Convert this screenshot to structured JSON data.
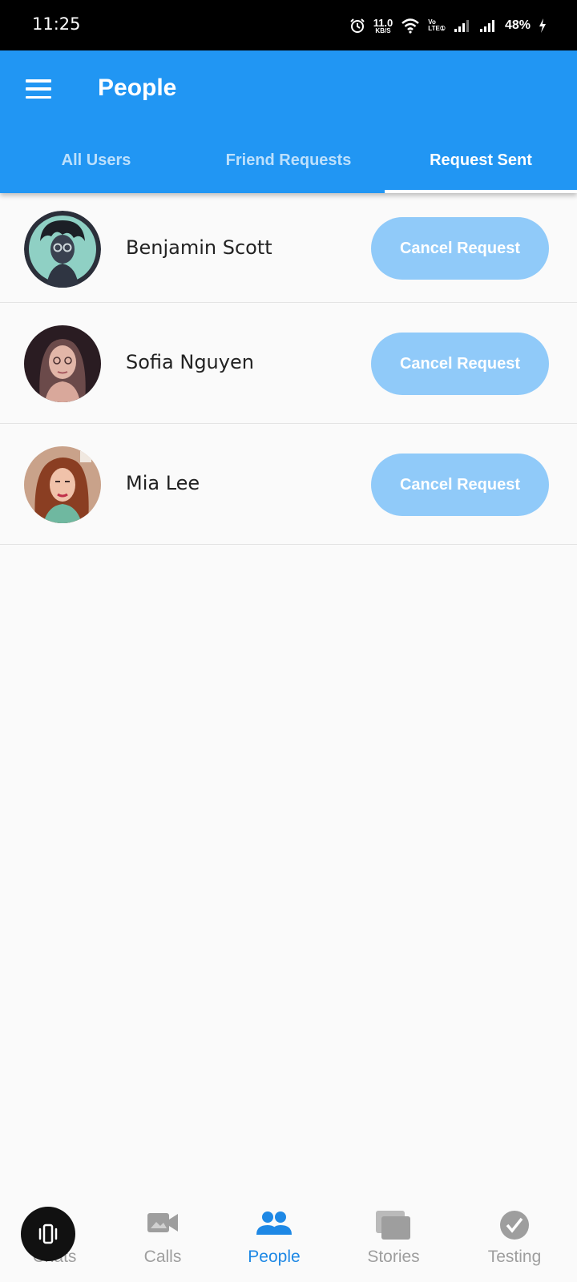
{
  "status_bar": {
    "time": "11:25",
    "net_speed_value": "11.0",
    "net_speed_unit": "KB/S",
    "volte_top": "Vo",
    "volte_bottom": "LTE①",
    "battery": "48%"
  },
  "app_bar": {
    "title": "People",
    "tabs": [
      {
        "label": "All Users",
        "active": false
      },
      {
        "label": "Friend Requests",
        "active": false
      },
      {
        "label": "Request Sent",
        "active": true
      }
    ]
  },
  "requests": [
    {
      "name": "Benjamin Scott",
      "action": "Cancel Request"
    },
    {
      "name": "Sofia Nguyen",
      "action": "Cancel Request"
    },
    {
      "name": "Mia Lee",
      "action": "Cancel Request"
    }
  ],
  "bottom_nav": [
    {
      "label": "Chats",
      "icon": "chat-icon",
      "active": false
    },
    {
      "label": "Calls",
      "icon": "video-camera-icon",
      "active": false
    },
    {
      "label": "People",
      "icon": "people-icon",
      "active": true
    },
    {
      "label": "Stories",
      "icon": "stories-icon",
      "active": false
    },
    {
      "label": "Testing",
      "icon": "check-circle-icon",
      "active": false
    }
  ],
  "colors": {
    "primary": "#2196f3",
    "button_disabled": "#90caf9",
    "nav_active": "#1e88e5",
    "nav_inactive": "#9e9e9e"
  }
}
